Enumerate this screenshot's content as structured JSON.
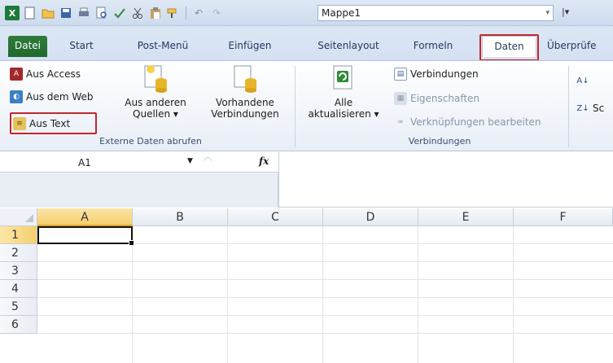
{
  "window": {
    "document_name": "Mappe1"
  },
  "tabs": [
    {
      "label": "Datei"
    },
    {
      "label": "Start"
    },
    {
      "label": "Post-Menü"
    },
    {
      "label": "Einfügen"
    },
    {
      "label": "Seitenlayout"
    },
    {
      "label": "Formeln"
    },
    {
      "label": "Daten"
    },
    {
      "label": "Überprüfe"
    }
  ],
  "ribbon": {
    "external_data": {
      "aus_access": "Aus Access",
      "aus_dem_web": "Aus dem Web",
      "aus_text": "Aus Text",
      "aus_anderen_line1": "Aus anderen",
      "aus_anderen_line2": "Quellen ▾",
      "vorhandene_line1": "Vorhandene",
      "vorhandene_line2": "Verbindungen",
      "group_label": "Externe Daten abrufen"
    },
    "connections": {
      "alle_line1": "Alle",
      "alle_line2": "aktualisieren ▾",
      "verbindungen": "Verbindungen",
      "eigenschaften": "Eigenschaften",
      "verknuepfungen": "Verknüpfungen bearbeiten",
      "group_label": "Verbindungen"
    },
    "sort": {
      "sort_label": "Sc"
    }
  },
  "formula_bar": {
    "name_box": "A1",
    "fx_label": "fx",
    "formula": ""
  },
  "grid": {
    "columns": [
      "A",
      "B",
      "C",
      "D",
      "E",
      "F"
    ],
    "rows": [
      "1",
      "2",
      "3",
      "4",
      "5",
      "6"
    ],
    "active_cell": "A1"
  },
  "colors": {
    "highlight": "#c0282d",
    "file_tab": "#1f6a2d",
    "selected_header": "#f5cf6a"
  }
}
